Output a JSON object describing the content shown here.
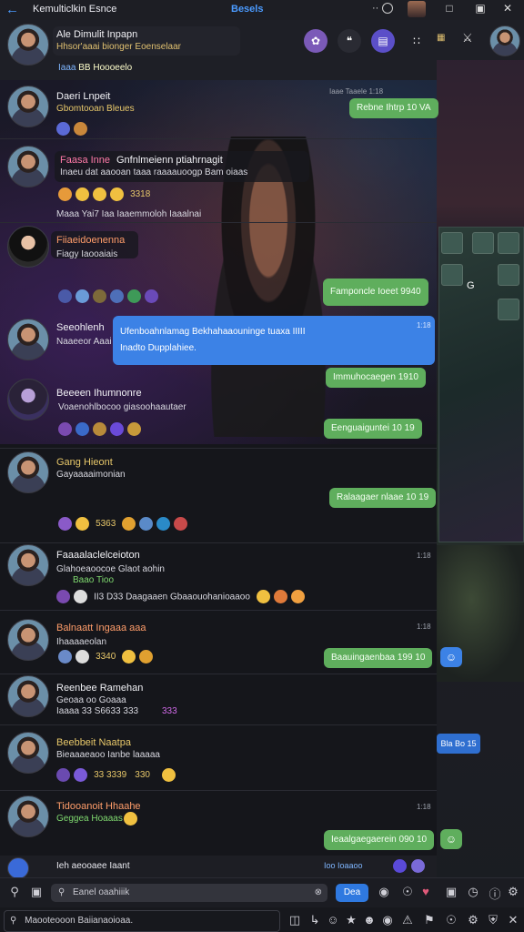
{
  "topbar": {
    "title": "Kemulticlkin Esnce",
    "center_label": "Besels",
    "dots": "··"
  },
  "header": {
    "name": "Ale Dimulit Inpapn",
    "subtitle": "Hhsor'aaai bionger Eoenselaar",
    "meta_tag": "Iaaa",
    "meta_text": "BB  Hoooeelo"
  },
  "messages": [
    {
      "name": "Daeri Lnpeit",
      "text": "Gbomtooan Bleues",
      "time": "Iaae Taaele  1:18",
      "reply": "Rebne Ihtrp 10 VA"
    },
    {
      "name": "Faasa Inne",
      "name2": "Gnfnlmeienn ptiahrnagit",
      "text": "Inaeu dat aaooan  taaa raaaauoogp  Bam oiaas",
      "emoji_label": "3318",
      "note": "Maaa Yai7 Iaa Iaaemmoloh Iaaalnai"
    },
    {
      "name": "Fiiaeidoenenna",
      "text": "Fiagy Iaooaiais",
      "reply": "Famponcle Ioeet  9940"
    },
    {
      "name": "Seeohlenh",
      "text": "Naaeeor Aaai",
      "time": "1:18",
      "blue_line1": "Ufenboahnlamag Bekhahaaouninge tuaxa  IIIII",
      "blue_line2": "Inadto Dupplahiee.",
      "reply": "Immuhocaegen  1910"
    },
    {
      "name": "Beeeen Ihumnonre",
      "text": "Voaenohlbocoo giasoohaautaer",
      "reply": "Eenguaiguntei  10 19"
    },
    {
      "name": "Gang Hieont",
      "text": "Gayaaaaimonian",
      "reply": "Ralaagaer nlaae  10 19",
      "emoji_label": "5363"
    },
    {
      "name": "Faaaalaclelceioton",
      "text": "Glahoeaoocoe Glaot  aohin",
      "green_text": "Baao Tioo",
      "long": "II3 D33 Daagaaen Gbaaouohanioaaoo",
      "time": "1:18"
    },
    {
      "name": "Balnaatt Ingaaa aaa",
      "text": "Ihaaaaeolan",
      "emoji_label": "3340",
      "reply": "Baauingaenbaa  199 10",
      "time": "1:18"
    },
    {
      "name": "Reenbee Ramehan",
      "text": "Geoaa oo Goaaa",
      "text2": "Iaaaa 33  S6633  333",
      "emoji_label": "333"
    },
    {
      "name": "Beebbeit Naatpa",
      "text": "Bieaaaeaoo Ianbe laaaaa",
      "emoji_label": "33  3339",
      "emoji_label2": "330"
    },
    {
      "name": "Tidooanoit Hhaahe",
      "text": "Geggea  Hoaaas",
      "reply": "Ieaalgaegaerein  090  10",
      "time": "1:18"
    }
  ],
  "partial": {
    "name": "Ieh aeooaee  Iaant",
    "text": "Ioo Ioaaoo"
  },
  "right_side": {
    "tile_label": "G",
    "badge": "Bla  Bo  15"
  },
  "composer": {
    "placeholder": "Eanel oaahiiik",
    "send_label": "Dea"
  },
  "footer": {
    "text": "Maooteooon Baiianaoioaa."
  },
  "colors": {
    "accent_blue": "#3c82e6",
    "bubble_green": "#5fae5d",
    "bg": "#15161b"
  }
}
